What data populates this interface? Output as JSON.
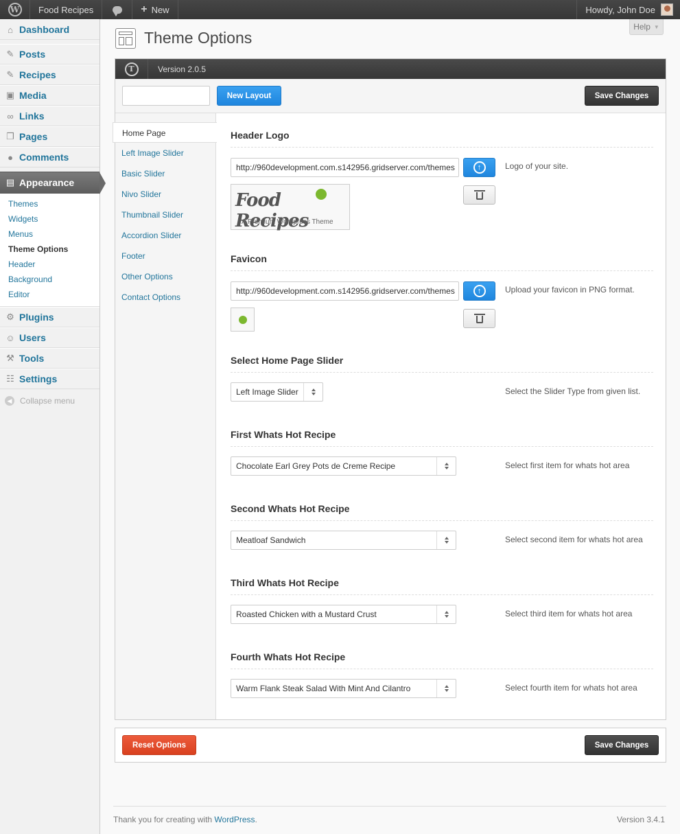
{
  "adminbar": {
    "site_name": "Food Recipes",
    "new_label": "New",
    "howdy": "Howdy, John Doe"
  },
  "sidebar": {
    "items": [
      {
        "label": "Dashboard",
        "icon": "dashboard-icon"
      },
      {
        "label": "Posts",
        "icon": "pin-icon"
      },
      {
        "label": "Recipes",
        "icon": "pin-icon"
      },
      {
        "label": "Media",
        "icon": "media-icon"
      },
      {
        "label": "Links",
        "icon": "link-icon"
      },
      {
        "label": "Pages",
        "icon": "pages-icon"
      },
      {
        "label": "Comments",
        "icon": "comment-icon"
      },
      {
        "label": "Appearance",
        "icon": "appearance-icon"
      },
      {
        "label": "Plugins",
        "icon": "plugin-icon"
      },
      {
        "label": "Users",
        "icon": "users-icon"
      },
      {
        "label": "Tools",
        "icon": "tools-icon"
      },
      {
        "label": "Settings",
        "icon": "settings-icon"
      }
    ],
    "submenu": [
      "Themes",
      "Widgets",
      "Menus",
      "Theme Options",
      "Header",
      "Background",
      "Editor"
    ],
    "collapse_label": "Collapse menu"
  },
  "page": {
    "title": "Theme Options",
    "help_label": "Help"
  },
  "panel": {
    "version": "Version 2.0.5",
    "layout_name_value": "",
    "new_layout_label": "New Layout",
    "save_label": "Save Changes",
    "tabs": [
      "Home Page",
      "Left Image Slider",
      "Basic Slider",
      "Nivo Slider",
      "Thumbnail Slider",
      "Accordion Slider",
      "Footer",
      "Other Options",
      "Contact Options"
    ],
    "header_logo": {
      "title": "Header Logo",
      "url": "http://960development.com.s142956.gridserver.com/themes",
      "desc": "Logo of your site.",
      "preview_text": "Food Recipes",
      "preview_tagline": "A Premium Wordpress Theme"
    },
    "favicon": {
      "title": "Favicon",
      "url": "http://960development.com.s142956.gridserver.com/themes",
      "desc": "Upload your favicon in PNG format."
    },
    "home_slider": {
      "title": "Select Home Page Slider",
      "value": "Left Image Slider",
      "desc": "Select the Slider Type from given list."
    },
    "hot1": {
      "title": "First Whats Hot Recipe",
      "value": "Chocolate Earl Grey Pots de Creme Recipe",
      "desc": "Select first item for whats hot area"
    },
    "hot2": {
      "title": "Second Whats Hot Recipe",
      "value": "Meatloaf Sandwich",
      "desc": "Select second item for whats hot area"
    },
    "hot3": {
      "title": "Third Whats Hot Recipe",
      "value": "Roasted Chicken with a Mustard Crust",
      "desc": "Select third item for whats hot area"
    },
    "hot4": {
      "title": "Fourth Whats Hot Recipe",
      "value": "Warm Flank Steak Salad With Mint And Cilantro",
      "desc": "Select fourth item for whats hot area"
    },
    "reset_label": "Reset Options"
  },
  "footer": {
    "thanks": "Thank you for creating with ",
    "link": "WordPress",
    "period": ".",
    "version": "Version 3.4.1"
  },
  "colors": {
    "link": "#21759b",
    "primary_button": "#1f86de",
    "reset_button": "#d9411f",
    "dark_button": "#333333",
    "logo_accent": "#7cb82f"
  }
}
